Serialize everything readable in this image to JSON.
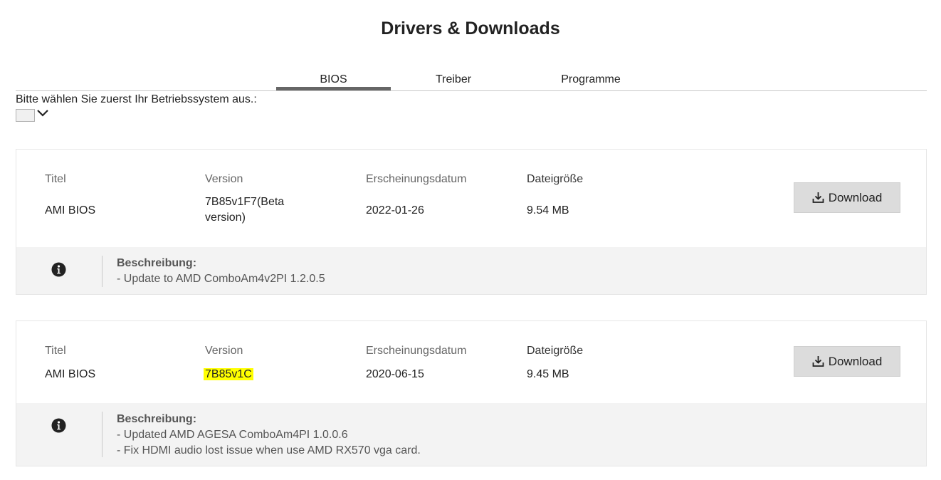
{
  "page": {
    "title": "Drivers & Downloads"
  },
  "tabs": [
    {
      "label": "BIOS",
      "active": true
    },
    {
      "label": "Treiber",
      "active": false
    },
    {
      "label": "Programme",
      "active": false
    }
  ],
  "os_selector": {
    "prompt": "Bitte wählen Sie zuerst Ihr Betriebssystem aus.:",
    "value": ""
  },
  "columns": {
    "title": "Titel",
    "version": "Version",
    "date": "Erscheinungsdatum",
    "size": "Dateigröße"
  },
  "downloads": [
    {
      "title": "AMI BIOS",
      "version_line1": "7B85v1F7(Beta",
      "version_line2": "version)",
      "date": "2022-01-26",
      "size": "9.54 MB",
      "button": "Download",
      "desc_title": "Beschreibung:",
      "desc_lines": [
        "- Update to AMD ComboAm4v2PI 1.2.0.5"
      ]
    },
    {
      "title": "AMI BIOS",
      "version": "7B85v1C",
      "date": "2020-06-15",
      "size": "9.45 MB",
      "button": "Download",
      "desc_title": "Beschreibung:",
      "desc_lines": [
        "- Updated AMD AGESA ComboAm4PI 1.0.0.6",
        "- Fix HDMI audio lost issue when use AMD RX570 vga card."
      ]
    }
  ],
  "colors": {
    "highlight": "#ffff00",
    "button_bg": "#dcdcdc",
    "desc_bg": "#f3f3f3",
    "active_tab": "#666666"
  },
  "icons": {
    "download": "download-icon",
    "info": "info-icon",
    "chevron": "chevron-down-icon"
  }
}
